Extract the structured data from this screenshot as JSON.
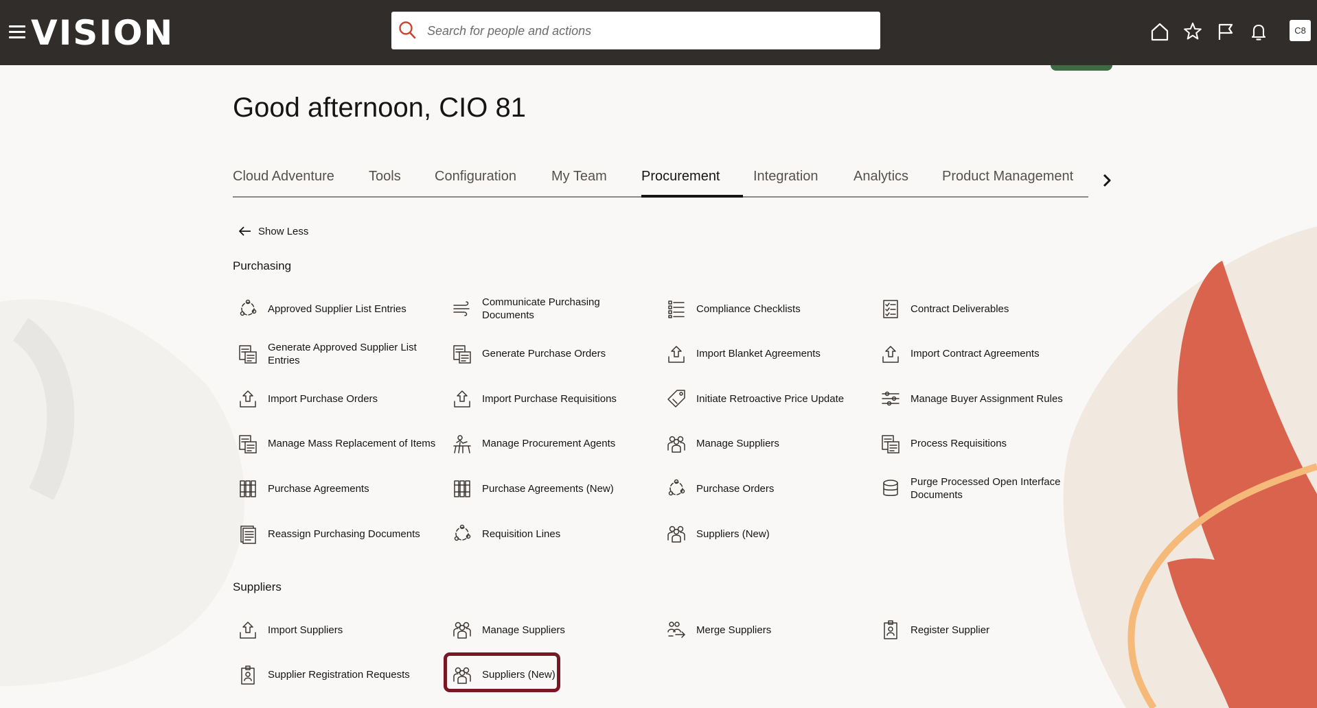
{
  "header": {
    "brand": "VISION",
    "search_placeholder": "Search for people and actions",
    "avatar_initials": "C8",
    "icons": [
      "menu-icon",
      "home-icon",
      "star-icon",
      "flag-icon",
      "bell-icon"
    ]
  },
  "greeting": "Good afternoon, CIO 81",
  "tabs": [
    {
      "label": "Cloud Adventure",
      "active": false
    },
    {
      "label": "Tools",
      "active": false
    },
    {
      "label": "Configuration",
      "active": false
    },
    {
      "label": "My Team",
      "active": false
    },
    {
      "label": "Procurement",
      "active": true
    },
    {
      "label": "Integration",
      "active": false
    },
    {
      "label": "Analytics",
      "active": false
    },
    {
      "label": "Product Management",
      "active": false
    }
  ],
  "show_less": "Show Less",
  "sections": {
    "purchasing": {
      "title": "Purchasing",
      "items": [
        {
          "label": "Approved Supplier List Entries",
          "icon": "cycle-icon"
        },
        {
          "label": "Communicate Purchasing Documents",
          "icon": "wind-icon"
        },
        {
          "label": "Compliance Checklists",
          "icon": "checklist-icon"
        },
        {
          "label": "Contract Deliverables",
          "icon": "checklist-doc-icon"
        },
        {
          "label": "Generate Approved Supplier List Entries",
          "icon": "generate-doc-icon"
        },
        {
          "label": "Generate Purchase Orders",
          "icon": "generate-doc-icon"
        },
        {
          "label": "Import Blanket Agreements",
          "icon": "upload-icon"
        },
        {
          "label": "Import Contract Agreements",
          "icon": "upload-icon"
        },
        {
          "label": "Import Purchase Orders",
          "icon": "upload-icon"
        },
        {
          "label": "Import Purchase Requisitions",
          "icon": "upload-icon"
        },
        {
          "label": "Initiate Retroactive Price Update",
          "icon": "price-tag-icon"
        },
        {
          "label": "Manage Buyer Assignment Rules",
          "icon": "sliders-icon"
        },
        {
          "label": "Manage Mass Replacement of Items",
          "icon": "generate-doc-icon"
        },
        {
          "label": "Manage Procurement Agents",
          "icon": "agent-desk-icon"
        },
        {
          "label": "Manage Suppliers",
          "icon": "people-group-icon"
        },
        {
          "label": "Process Requisitions",
          "icon": "generate-doc-icon"
        },
        {
          "label": "Purchase Agreements",
          "icon": "binders-icon"
        },
        {
          "label": "Purchase Agreements (New)",
          "icon": "binders-icon"
        },
        {
          "label": "Purchase Orders",
          "icon": "cycle-icon"
        },
        {
          "label": "Purge Processed Open Interface Documents",
          "icon": "database-icon"
        },
        {
          "label": "Reassign Purchasing Documents",
          "icon": "document-icon"
        },
        {
          "label": "Requisition Lines",
          "icon": "cycle-icon"
        },
        {
          "label": "Suppliers (New)",
          "icon": "people-group-icon"
        }
      ]
    },
    "suppliers": {
      "title": "Suppliers",
      "items": [
        {
          "label": "Import Suppliers",
          "icon": "upload-icon"
        },
        {
          "label": "Manage Suppliers",
          "icon": "people-group-icon"
        },
        {
          "label": "Merge Suppliers",
          "icon": "merge-people-icon"
        },
        {
          "label": "Register Supplier",
          "icon": "register-badge-icon"
        },
        {
          "label": "Supplier Registration Requests",
          "icon": "register-badge-icon"
        },
        {
          "label": "Suppliers (New)",
          "icon": "people-group-icon",
          "highlighted": true
        }
      ]
    }
  }
}
